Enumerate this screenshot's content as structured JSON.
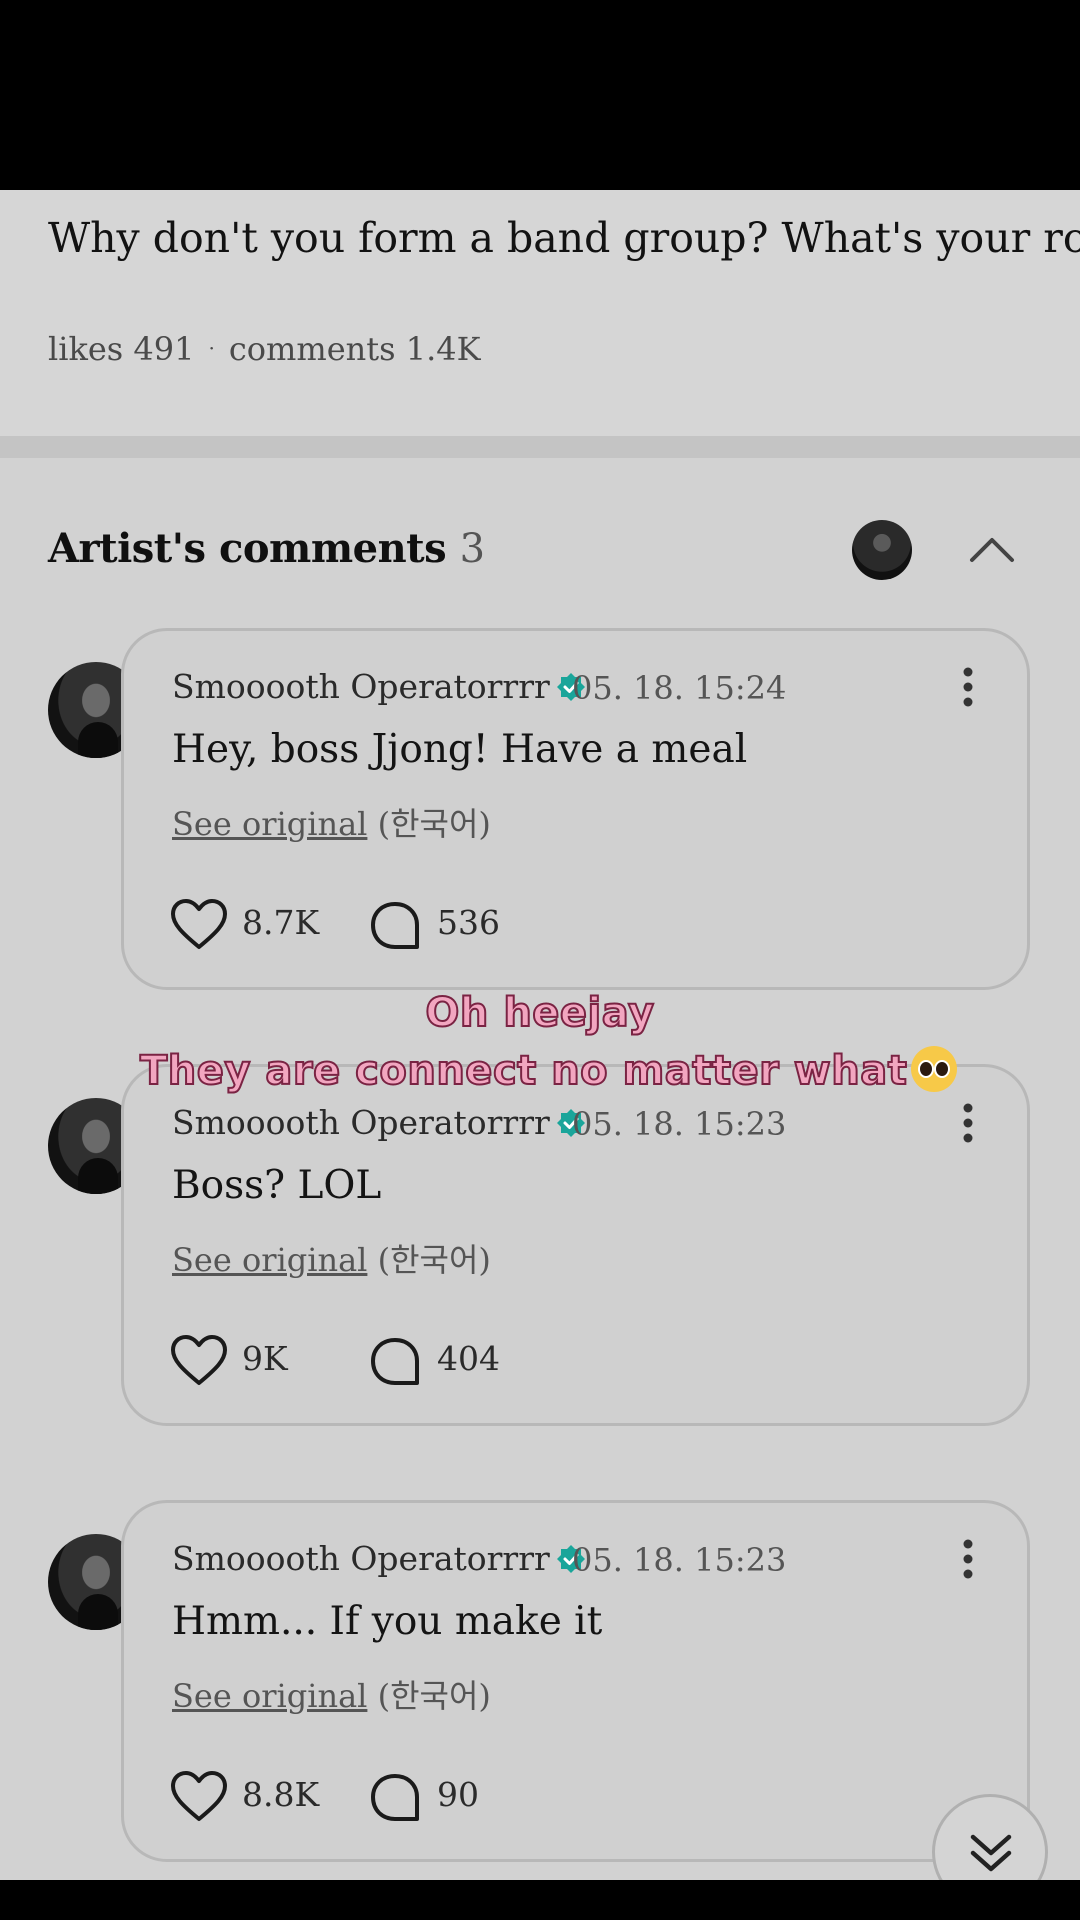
{
  "post": {
    "question": "Why don't you form a band group? What's your role",
    "likes_label": "likes 491",
    "separator": "·",
    "comments_label": "comments 1.4K"
  },
  "artist_comments": {
    "title": "Artist's comments",
    "count": "3"
  },
  "comments": [
    {
      "author": "Smooooth Operatorrrr",
      "time": "05. 18. 15:24",
      "text": "Hey, boss Jjong! Have a meal",
      "see_original": "See original",
      "language": "(한국어)",
      "likes": "8.7K",
      "replies": "536"
    },
    {
      "author": "Smooooth Operatorrrr",
      "time": "05. 18. 15:23",
      "text": "Boss? LOL",
      "see_original": "See original",
      "language": "(한국어)",
      "likes": "9K",
      "replies": "404"
    },
    {
      "author": "Smooooth Operatorrrr",
      "time": "05. 18. 15:23",
      "text": "Hmm... If you make it",
      "see_original": "See original",
      "language": "(한국어)",
      "likes": "8.8K",
      "replies": "90"
    }
  ],
  "overlay": {
    "line1": "Oh heejay",
    "line2": "They are connect no matter what"
  },
  "icons": {
    "verified": "verified-check-icon",
    "like": "heart-icon",
    "reply": "speech-bubble-icon",
    "more": "more-vertical-icon",
    "collapse": "chevron-up-icon",
    "scroll": "double-chevron-down-icon"
  },
  "colors": {
    "background": "#d2d2d2",
    "verified": "#1aa59a",
    "caption_fill": "#f2a6c0",
    "caption_stroke": "#7a2343"
  }
}
